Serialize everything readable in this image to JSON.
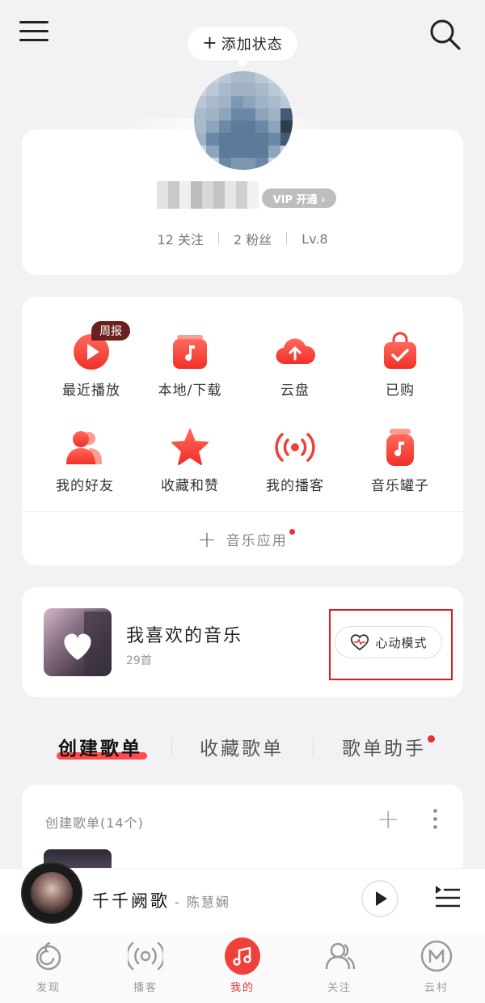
{
  "header": {
    "status_button_plus": "+",
    "status_button_label": "添加状态"
  },
  "profile": {
    "vip_badge": "VIP 开通 ›",
    "following": "12 关注",
    "followers": "2 粉丝",
    "level": "Lv.8"
  },
  "functions": {
    "weekly_badge": "周报",
    "items": [
      {
        "label": "最近播放",
        "icon": "play-circle-icon"
      },
      {
        "label": "本地/下载",
        "icon": "music-folder-icon"
      },
      {
        "label": "云盘",
        "icon": "cloud-upload-icon"
      },
      {
        "label": "已购",
        "icon": "shopping-bag-icon"
      },
      {
        "label": "我的好友",
        "icon": "friends-icon"
      },
      {
        "label": "收藏和赞",
        "icon": "star-icon"
      },
      {
        "label": "我的播客",
        "icon": "podcast-icon"
      },
      {
        "label": "音乐罐子",
        "icon": "music-jar-icon"
      }
    ],
    "music_app_plus": "+",
    "music_app_label": "音乐应用"
  },
  "liked": {
    "title": "我喜欢的音乐",
    "count": "29首",
    "heart_mode_label": "心动模式"
  },
  "playlist_tabs": {
    "tabs": [
      "创建歌单",
      "收藏歌单",
      "歌单助手"
    ],
    "active_index": 0
  },
  "created": {
    "title": "创建歌单(14个)",
    "add": "+"
  },
  "player": {
    "song": "千千阙歌",
    "artist": "- 陈慧娴"
  },
  "nav": {
    "items": [
      "发现",
      "播客",
      "我的",
      "关注",
      "云村"
    ],
    "active_index": 2
  },
  "colors": {
    "accent": "#f0403a",
    "badge_dark": "#6b1f1f",
    "highlight": "#e01818"
  }
}
